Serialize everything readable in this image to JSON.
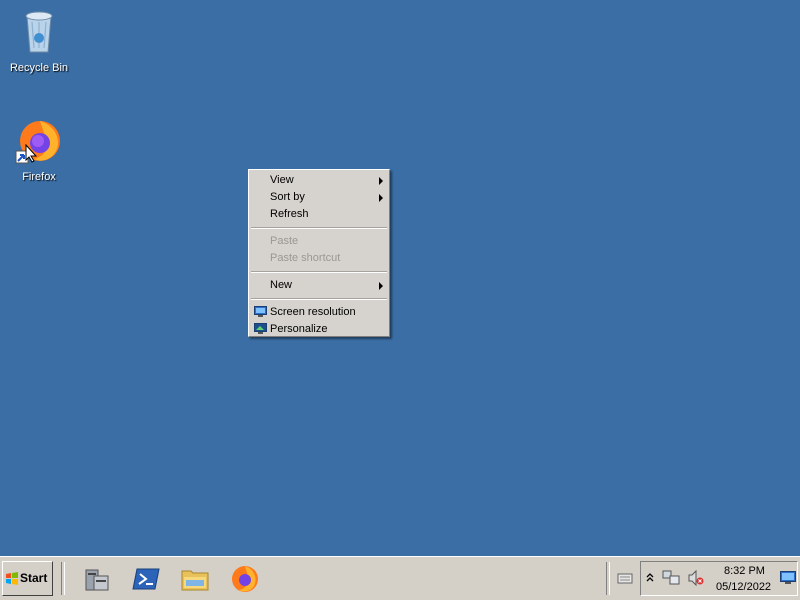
{
  "desktop": {
    "background": "#3a6ea5",
    "icons": [
      {
        "label": "Recycle Bin",
        "icon": "recycle-bin-icon"
      },
      {
        "label": "Firefox",
        "icon": "firefox-icon"
      }
    ]
  },
  "context_menu": {
    "items": [
      {
        "label": "View",
        "submenu": true,
        "enabled": true
      },
      {
        "label": "Sort by",
        "submenu": true,
        "enabled": true
      },
      {
        "label": "Refresh",
        "submenu": false,
        "enabled": true
      },
      {
        "label": "Paste",
        "submenu": false,
        "enabled": false
      },
      {
        "label": "Paste shortcut",
        "submenu": false,
        "enabled": false
      },
      {
        "label": "New",
        "submenu": true,
        "enabled": true
      },
      {
        "label": "Screen resolution",
        "icon": "monitor-icon",
        "enabled": true
      },
      {
        "label": "Personalize",
        "icon": "personalize-icon",
        "enabled": true
      }
    ]
  },
  "taskbar": {
    "start_label": "Start",
    "quick_launch": [
      "server-manager-icon",
      "powershell-icon",
      "file-explorer-icon",
      "firefox-icon"
    ],
    "tray_icons": [
      "keyboard-icon",
      "show-hidden-icons-arrow",
      "network-icon",
      "volume-muted-icon",
      "show-desktop-icon"
    ],
    "clock": {
      "time": "8:32 PM",
      "date": "05/12/2022"
    }
  }
}
